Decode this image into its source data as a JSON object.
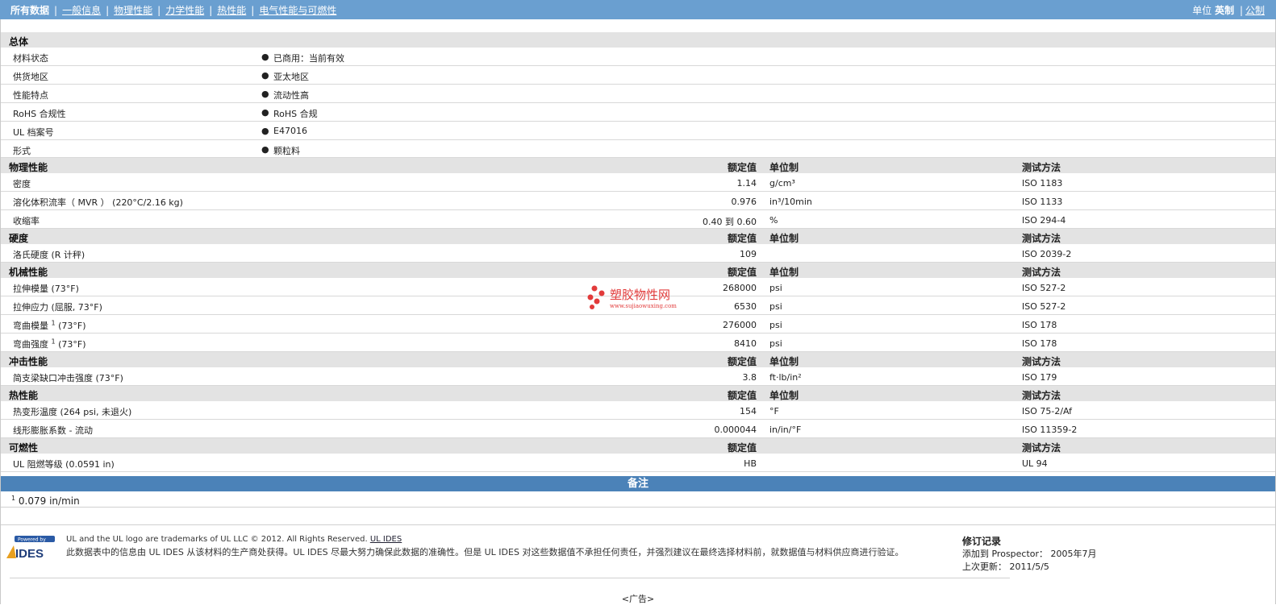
{
  "topnav": {
    "all": "所有数据",
    "links": [
      "一般信息",
      "物理性能",
      "力学性能",
      "热性能",
      "电气性能与可燃性"
    ],
    "unit_label": "单位",
    "unit_current": "英制",
    "unit_alt": "公制"
  },
  "general": {
    "title": "总体",
    "items": [
      {
        "label": "材料状态",
        "value": "已商用：当前有效"
      },
      {
        "label": "供货地区",
        "value": "亚太地区"
      },
      {
        "label": "性能特点",
        "value": "流动性高"
      },
      {
        "label": "RoHS 合规性",
        "value": "RoHS 合规"
      },
      {
        "label": "UL 档案号",
        "value": "E47016"
      },
      {
        "label": "形式",
        "value": "颗粒料"
      }
    ]
  },
  "headers": {
    "nominal": "额定值",
    "unit": "单位制",
    "method": "测试方法"
  },
  "physical": {
    "title": "物理性能",
    "rows": [
      {
        "label": "密度",
        "value": "1.14",
        "unit": "g/cm³",
        "method": "ISO 1183"
      },
      {
        "label": "溶化体积流率（ MVR ） (220°C/2.16 kg)",
        "value": "0.976",
        "unit": "in³/10min",
        "method": "ISO 1133"
      },
      {
        "label": "收缩率",
        "value": "0.40 到  0.60",
        "unit": "%",
        "method": "ISO 294-4"
      }
    ]
  },
  "hardness": {
    "title": "硬度",
    "rows": [
      {
        "label": "洛氏硬度 (R 计秤)",
        "value": "109",
        "unit": "",
        "method": "ISO 2039-2"
      }
    ]
  },
  "mechanical": {
    "title": "机械性能",
    "rows": [
      {
        "label": "拉伸模量 (73°F)",
        "sup": "",
        "label2": "",
        "value": "268000",
        "unit": "psi",
        "method": "ISO 527-2"
      },
      {
        "label": "拉伸应力 (屈服, 73°F)",
        "sup": "",
        "label2": "",
        "value": "6530",
        "unit": "psi",
        "method": "ISO 527-2"
      },
      {
        "label": "弯曲模量 ",
        "sup": "1",
        "label2": " (73°F)",
        "value": "276000",
        "unit": "psi",
        "method": "ISO 178"
      },
      {
        "label": "弯曲强度 ",
        "sup": "1",
        "label2": " (73°F)",
        "value": "8410",
        "unit": "psi",
        "method": "ISO 178"
      }
    ]
  },
  "impact": {
    "title": "冲击性能",
    "rows": [
      {
        "label": "简支梁缺口冲击强度 (73°F)",
        "value": "3.8",
        "unit": "ft·lb/in²",
        "method": "ISO 179"
      }
    ]
  },
  "thermal": {
    "title": "热性能",
    "rows": [
      {
        "label": "热变形温度 (264 psi, 未退火)",
        "value": "154",
        "unit": "°F",
        "method": "ISO 75-2/Af"
      },
      {
        "label": "线形膨胀系数  - 流动",
        "value": "0.000044",
        "unit": "in/in/°F",
        "method": "ISO 11359-2"
      }
    ]
  },
  "flammability": {
    "title": "可燃性",
    "rows": [
      {
        "label": "UL 阻燃等级 (0.0591 in)",
        "value": "HB",
        "unit": "",
        "method": "UL 94"
      }
    ]
  },
  "notes": {
    "title": "备注",
    "items": [
      {
        "num": "1",
        "text": "0.079 in/min"
      }
    ]
  },
  "footer": {
    "logo_top": "Powered by",
    "logo_text": "IDES",
    "legal_line1": "UL and the UL logo are trademarks of UL LLC © 2012. All Rights Reserved.",
    "legal_link": "UL IDES",
    "legal_line2": "此数据表中的信息由  UL IDES 从该材料的生产商处获得。UL IDES 尽最大努力确保此数据的准确性。但是  UL IDES 对这些数据值不承担任何责任，并强烈建议在最终选择材料前，就数据值与材料供应商进行验证。",
    "rev_title": "修订记录",
    "rev_added": "添加到  Prospector：  2005年7月",
    "rev_updated": "上次更新：  2011/5/5",
    "ad": "<广告>"
  },
  "watermark": {
    "title": "塑胶物性网",
    "url": "www.sujiaowuxing.com"
  },
  "colors": {
    "topbar": "#6a9fd0",
    "section": "#e3e3e3",
    "notes_bar": "#4b82b8",
    "watermark": "#e23b3b"
  }
}
